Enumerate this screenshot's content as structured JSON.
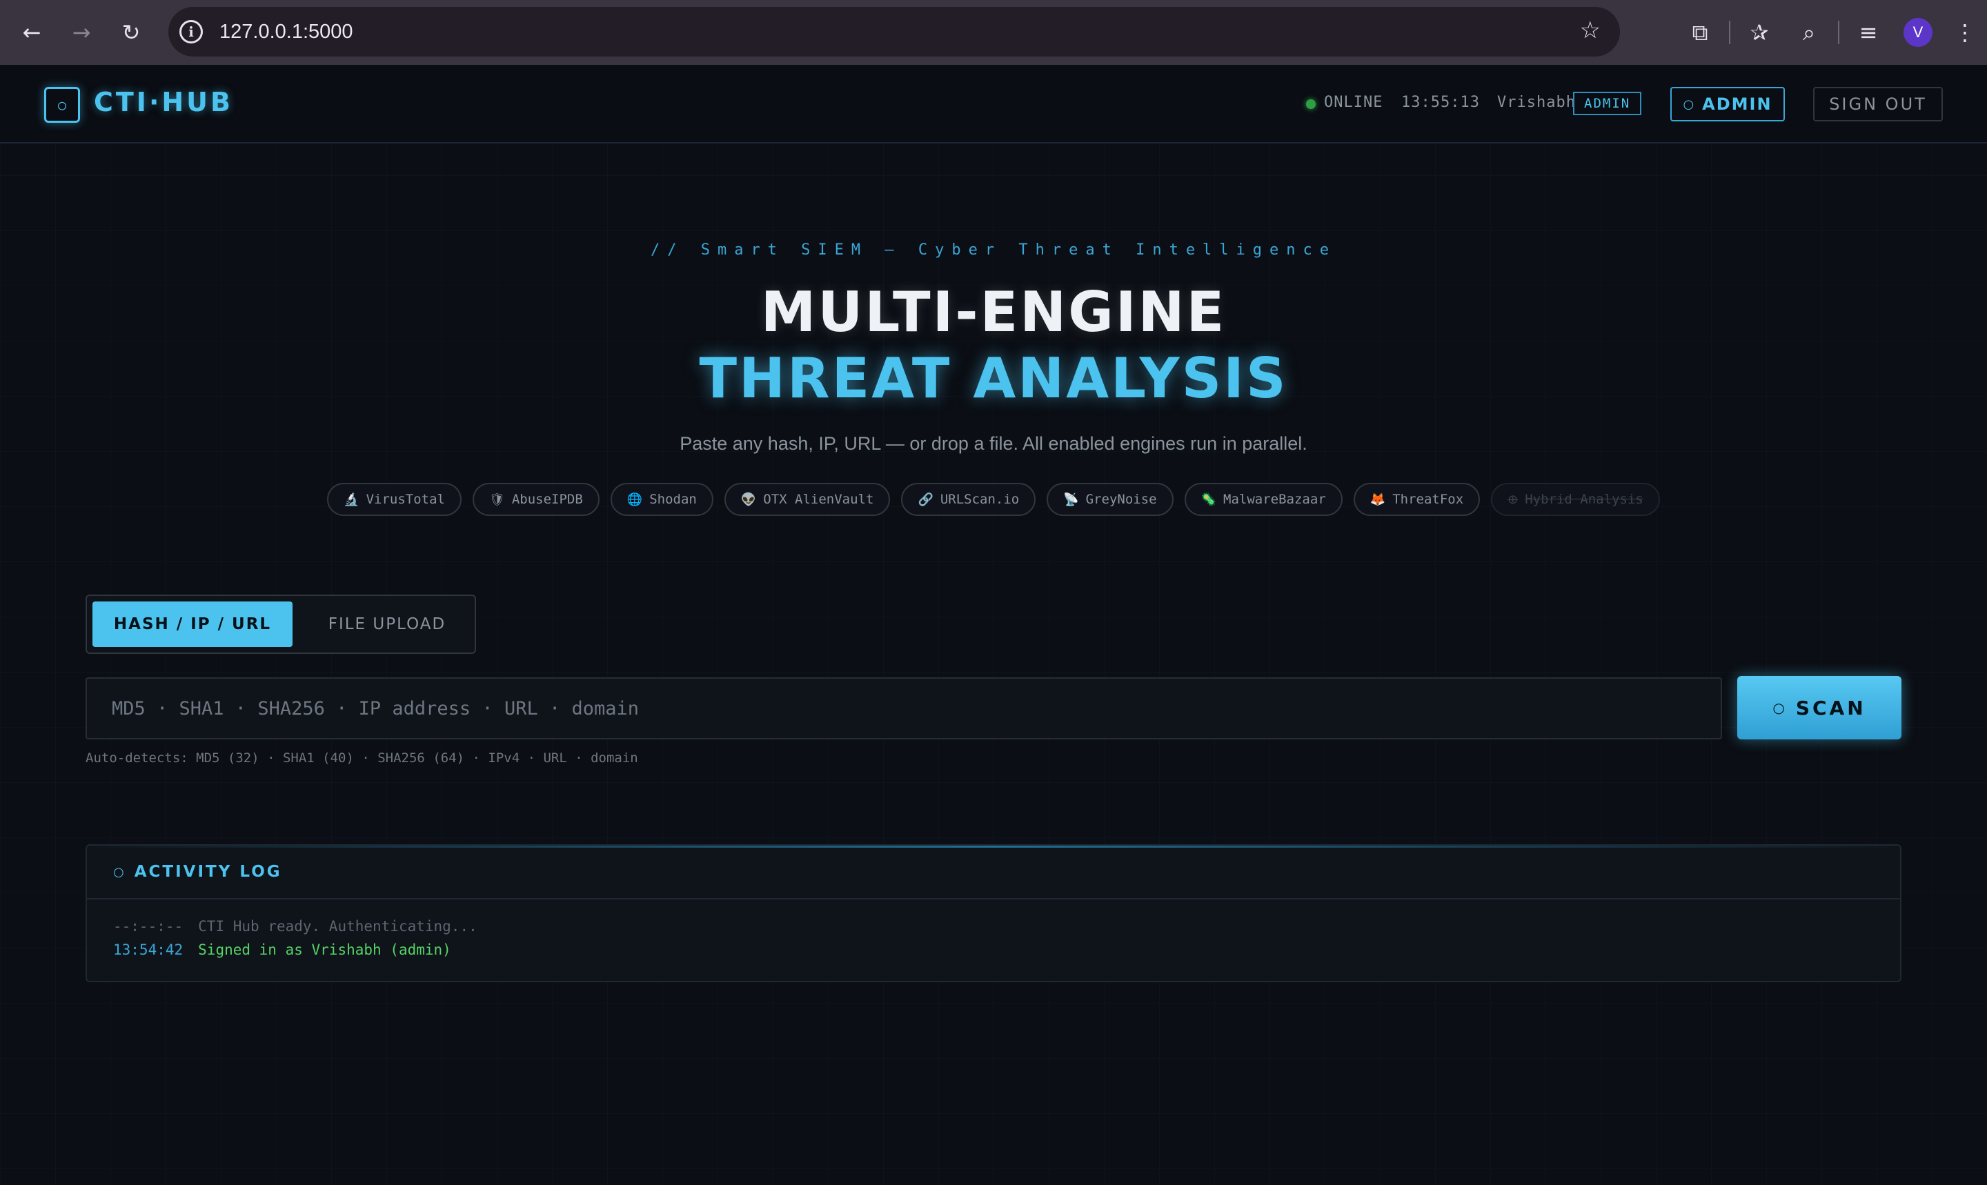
{
  "browser": {
    "url": "127.0.0.1:5000",
    "profile_initial": "V"
  },
  "header": {
    "logo_icon": "hexagon-icon",
    "logo_symbol": "○",
    "brand": "CTI·HUB",
    "status": "ONLINE",
    "time": "13:55:13",
    "username": "Vrishabh",
    "role": "ADMIN",
    "admin_button": "ADMIN",
    "signout_button": "SIGN OUT"
  },
  "hero": {
    "tagline": "// Smart SIEM — Cyber Threat Intelligence",
    "title_line1": "MULTI-ENGINE",
    "title_line2": "THREAT ANALYSIS",
    "subtitle": "Paste any hash, IP, URL — or drop a file. All enabled engines run in parallel."
  },
  "engines": [
    {
      "icon": "🔬",
      "label": "VirusTotal",
      "enabled": true
    },
    {
      "icon": "🛡",
      "label": "AbuseIPDB",
      "enabled": true
    },
    {
      "icon": "🌐",
      "label": "Shodan",
      "enabled": true
    },
    {
      "icon": "👽",
      "label": "OTX AlienVault",
      "enabled": true
    },
    {
      "icon": "🔗",
      "label": "URLScan.io",
      "enabled": true
    },
    {
      "icon": "📡",
      "label": "GreyNoise",
      "enabled": true
    },
    {
      "icon": "🦠",
      "label": "MalwareBazaar",
      "enabled": true
    },
    {
      "icon": "🦊",
      "label": "ThreatFox",
      "enabled": true
    },
    {
      "icon": "⊕",
      "label": "Hybrid Analysis",
      "enabled": false
    }
  ],
  "tabs": {
    "active": "HASH / IP / URL",
    "inactive": "FILE UPLOAD"
  },
  "search": {
    "placeholder": "MD5 · SHA1 · SHA256 · IP address · URL · domain",
    "value": "",
    "scan_button": "SCAN",
    "hint": "Auto-detects: MD5 (32) · SHA1 (40) · SHA256 (64) · IPv4 · URL · domain"
  },
  "activity_log": {
    "title": "ACTIVITY LOG",
    "entries": [
      {
        "time": "--:--:--",
        "message": "CTI Hub ready. Authenticating..."
      },
      {
        "time": "13:54:42",
        "message": "Signed in as Vrishabh (admin)"
      }
    ]
  },
  "colors": {
    "accent": "#4cc3ee",
    "background": "#0b0e14",
    "success": "#56d364",
    "online": "#2ea043"
  }
}
